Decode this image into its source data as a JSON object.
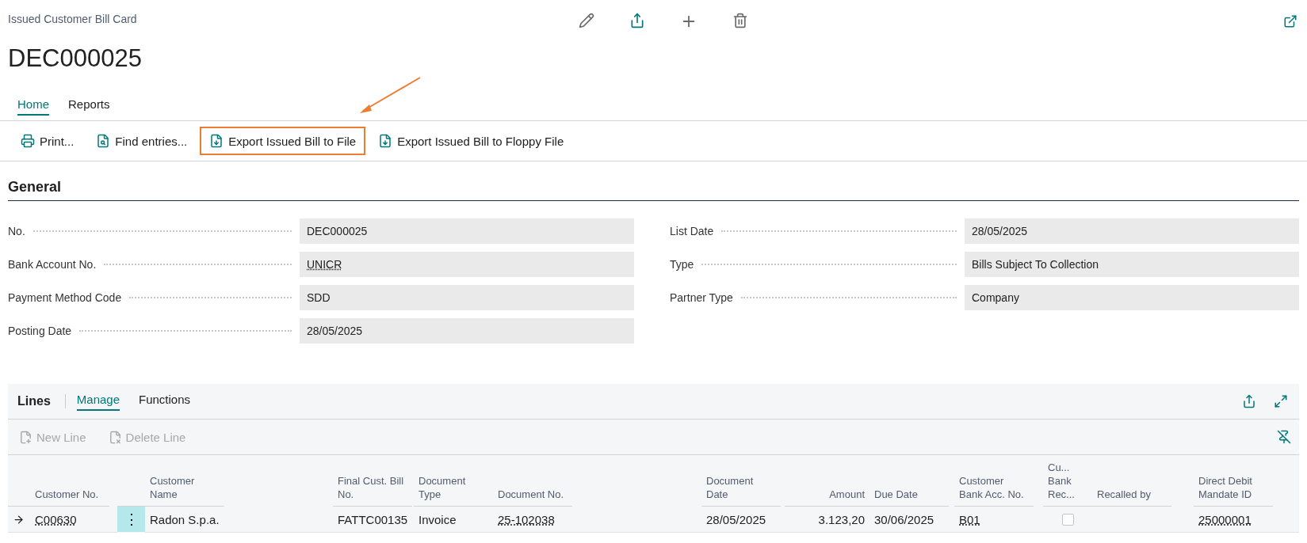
{
  "page": {
    "caption": "Issued Customer Bill Card",
    "title": "DEC000025"
  },
  "tabs": [
    {
      "label": "Home",
      "selected": true
    },
    {
      "label": "Reports",
      "selected": false
    }
  ],
  "actions": [
    {
      "label": "Print...",
      "kind": "print",
      "highlighted": false
    },
    {
      "label": "Find entries...",
      "kind": "find",
      "highlighted": false
    },
    {
      "label": "Export Issued Bill to File",
      "kind": "export",
      "highlighted": true
    },
    {
      "label": "Export Issued Bill to Floppy File",
      "kind": "export",
      "highlighted": false
    }
  ],
  "general": {
    "title": "General",
    "left": [
      {
        "label": "No.",
        "value": "DEC000025",
        "linked": false
      },
      {
        "label": "Bank Account No.",
        "value": "UNICR",
        "linked": true
      },
      {
        "label": "Payment Method Code",
        "value": "SDD",
        "linked": false
      },
      {
        "label": "Posting Date",
        "value": "28/05/2025",
        "linked": false
      }
    ],
    "right": [
      {
        "label": "List Date",
        "value": "28/05/2025",
        "linked": false
      },
      {
        "label": "Type",
        "value": "Bills Subject To Collection",
        "linked": false
      },
      {
        "label": "Partner Type",
        "value": "Company",
        "linked": false
      }
    ]
  },
  "lines": {
    "title": "Lines",
    "tabs": [
      {
        "label": "Manage",
        "selected": true
      },
      {
        "label": "Functions",
        "selected": false
      }
    ],
    "actions": [
      {
        "label": "New Line",
        "kind": "new",
        "disabled": true
      },
      {
        "label": "Delete Line",
        "kind": "delete",
        "disabled": true
      }
    ],
    "columns": [
      {
        "label": "Customer No.",
        "kind": "link"
      },
      {
        "kind": "menu"
      },
      {
        "label": "Customer Name",
        "kind": "text"
      },
      {
        "label": "Final Cust. Bill No.",
        "kind": "text"
      },
      {
        "label": "Document Type",
        "kind": "text"
      },
      {
        "label": "Document No.",
        "kind": "link"
      },
      {
        "label": "Document Date",
        "kind": "text"
      },
      {
        "label": "Amount",
        "kind": "number"
      },
      {
        "label": "Due Date",
        "kind": "text"
      },
      {
        "label": "Customer Bank Acc. No.",
        "kind": "link"
      },
      {
        "label": "Cu... Bank Rec...",
        "kind": "checkbox"
      },
      {
        "label": "Recalled by",
        "kind": "text"
      },
      {
        "label": "Direct Debit Mandate ID",
        "kind": "link"
      }
    ],
    "rows": [
      {
        "current": true,
        "cells": [
          "C00630",
          "⋮",
          "Radon S.p.a.",
          "FATTC00135",
          "Invoice",
          "25-102038",
          "28/05/2025",
          "3.123,20",
          "30/06/2025",
          "B01",
          false,
          "",
          "25000001"
        ]
      }
    ]
  }
}
